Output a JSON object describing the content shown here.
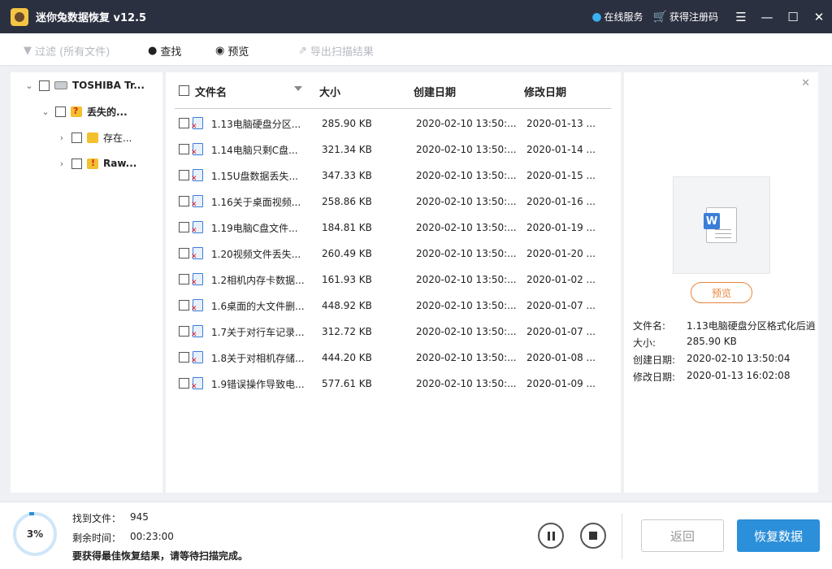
{
  "app": {
    "title": "迷你兔数据恢复 v12.5",
    "online_service": "在线服务",
    "get_code": "获得注册码"
  },
  "toolbar": {
    "filter": "过滤 (所有文件)",
    "find": "查找",
    "preview": "预览",
    "export": "导出扫描结果"
  },
  "tree": {
    "drive": "TOSHIBA Tr...",
    "lost": "丢失的...",
    "existing": "存在...",
    "raw": "Raw..."
  },
  "list": {
    "headers": {
      "name": "文件名",
      "size": "大小",
      "created": "创建日期",
      "modified": "修改日期"
    },
    "rows": [
      {
        "name": "1.13电脑硬盘分区...",
        "size": "285.90 KB",
        "created": "2020-02-10 13:50:...",
        "modified": "2020-01-13 ..."
      },
      {
        "name": "1.14电脑只剩C盘...",
        "size": "321.34 KB",
        "created": "2020-02-10 13:50:...",
        "modified": "2020-01-14 ..."
      },
      {
        "name": "1.15U盘数据丢失...",
        "size": "347.33 KB",
        "created": "2020-02-10 13:50:...",
        "modified": "2020-01-15 ..."
      },
      {
        "name": "1.16关于桌面视频...",
        "size": "258.86 KB",
        "created": "2020-02-10 13:50:...",
        "modified": "2020-01-16 ..."
      },
      {
        "name": "1.19电脑C盘文件...",
        "size": "184.81 KB",
        "created": "2020-02-10 13:50:...",
        "modified": "2020-01-19 ..."
      },
      {
        "name": "1.20视频文件丢失...",
        "size": "260.49 KB",
        "created": "2020-02-10 13:50:...",
        "modified": "2020-01-20 ..."
      },
      {
        "name": "1.2相机内存卡数据...",
        "size": "161.93 KB",
        "created": "2020-02-10 13:50:...",
        "modified": "2020-01-02 ..."
      },
      {
        "name": "1.6桌面的大文件删...",
        "size": "448.92 KB",
        "created": "2020-02-10 13:50:...",
        "modified": "2020-01-07 ..."
      },
      {
        "name": "1.7关于对行车记录...",
        "size": "312.72 KB",
        "created": "2020-02-10 13:50:...",
        "modified": "2020-01-07 ..."
      },
      {
        "name": "1.8关于对相机存储...",
        "size": "444.20 KB",
        "created": "2020-02-10 13:50:...",
        "modified": "2020-01-08 ..."
      },
      {
        "name": "1.9错误操作导致电...",
        "size": "577.61 KB",
        "created": "2020-02-10 13:50:...",
        "modified": "2020-01-09 ..."
      }
    ]
  },
  "preview": {
    "thumb_letter": "W",
    "button": "预览",
    "labels": {
      "name": "文件名:",
      "size": "大小:",
      "created": "创建日期:",
      "modified": "修改日期:"
    },
    "values": {
      "name": "1.13电脑硬盘分区格式化后逍",
      "size": "285.90 KB",
      "created": "2020-02-10 13:50:04",
      "modified": "2020-01-13 16:02:08"
    }
  },
  "status": {
    "progress": "3%",
    "found_label": "找到文件：",
    "found_value": "945",
    "remaining_label": "剩余时间：",
    "remaining_value": "00:23:00",
    "hint": "要获得最佳恢复结果，请等待扫描完成。",
    "back": "返回",
    "recover": "恢复数据"
  },
  "colors": {
    "titlebar": "#2b3040",
    "accent": "#2b8fd9",
    "preview_accent": "#e8843a"
  }
}
